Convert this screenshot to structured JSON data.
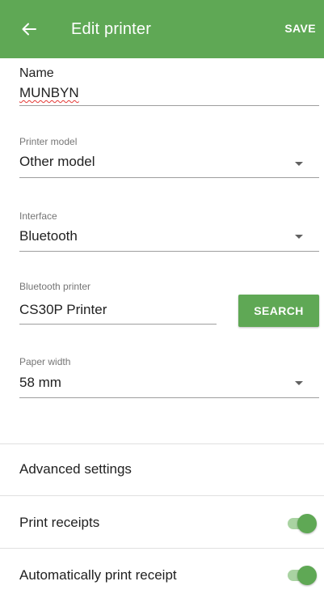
{
  "appbar": {
    "title": "Edit printer",
    "save_label": "SAVE",
    "back_icon": "arrow-left-icon"
  },
  "colors": {
    "primary": "#5fa855",
    "toggle_track": "#a9d3a2",
    "label": "#757575",
    "text": "#212121"
  },
  "form": {
    "name": {
      "label": "Name",
      "value": "MUNBYN"
    },
    "printer_model": {
      "label": "Printer model",
      "value": "Other model"
    },
    "interface": {
      "label": "Interface",
      "value": "Bluetooth"
    },
    "bluetooth_printer": {
      "label": "Bluetooth printer",
      "value": "CS30P Printer",
      "search_label": "SEARCH"
    },
    "paper_width": {
      "label": "Paper width",
      "value": "58 mm"
    }
  },
  "settings": {
    "advanced_label": "Advanced settings",
    "print_receipts": {
      "label": "Print receipts",
      "enabled": true
    },
    "auto_print_receipt": {
      "label": "Automatically print receipt",
      "enabled": true
    }
  }
}
